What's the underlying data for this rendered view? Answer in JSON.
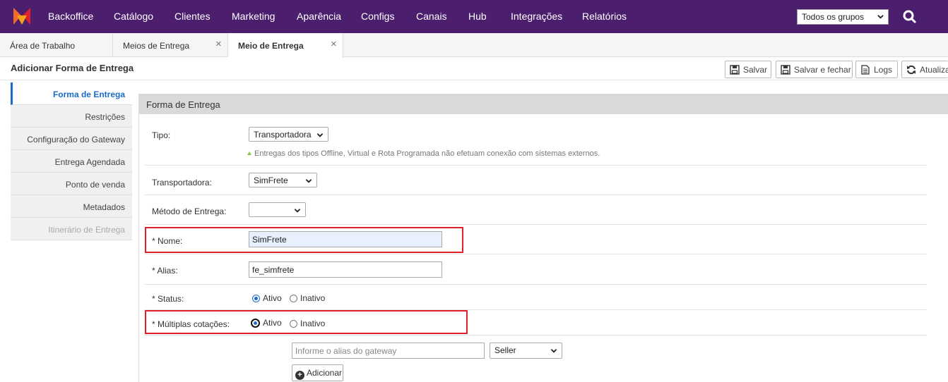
{
  "topnav": {
    "logo": "brand-logo-icon",
    "items": [
      "Backoffice",
      "Catálogo",
      "Clientes",
      "Marketing",
      "Aparência",
      "Configs",
      "Canais",
      "Hub",
      "Integrações",
      "Relatórios"
    ],
    "group_select": "Todos os grupos"
  },
  "tabs": [
    {
      "label": "Área de Trabalho",
      "closable": false
    },
    {
      "label": "Meios de Entrega",
      "closable": true,
      "close": "×"
    },
    {
      "label": "Meio de Entrega",
      "closable": true,
      "active": true,
      "close": "×"
    }
  ],
  "page": {
    "title": "Adicionar Forma de Entrega",
    "toolbar": {
      "save": "Salvar",
      "save_close": "Salvar e fechar",
      "logs": "Logs",
      "refresh": "Atualizar"
    }
  },
  "sidemenu": [
    "Forma de Entrega",
    "Restrições",
    "Configuração do Gateway",
    "Entrega Agendada",
    "Ponto de venda",
    "Metadados",
    "Itinerário de Entrega"
  ],
  "form": {
    "header": "Forma de Entrega",
    "tipo": {
      "label": "Tipo:",
      "value": "Transportadora",
      "hint": "Entregas dos tipos Offline, Virtual e Rota Programada não efetuam conexão com sistemas externos."
    },
    "transportadora": {
      "label": "Transportadora:",
      "value": "SimFrete"
    },
    "metodo": {
      "label": "Método de Entrega:",
      "value": ""
    },
    "nome": {
      "label": "* Nome:",
      "value": "SimFrete"
    },
    "alias": {
      "label": "* Alias:",
      "value": "fe_simfrete"
    },
    "status": {
      "label": "* Status:",
      "options": [
        "Ativo",
        "Inativo"
      ],
      "selected": "Ativo"
    },
    "multiplas": {
      "label": "* Múltiplas cotações:",
      "options": [
        "Ativo",
        "Inativo"
      ],
      "selected": "Ativo"
    },
    "gateway": {
      "placeholder": "Informe o alias do gateway",
      "type_value": "Seller",
      "add_label": "Adicionar"
    }
  },
  "colors": {
    "nav_bg": "#4b1f6e",
    "accent": "#1a6cc8",
    "highlight": "#e0202a"
  }
}
